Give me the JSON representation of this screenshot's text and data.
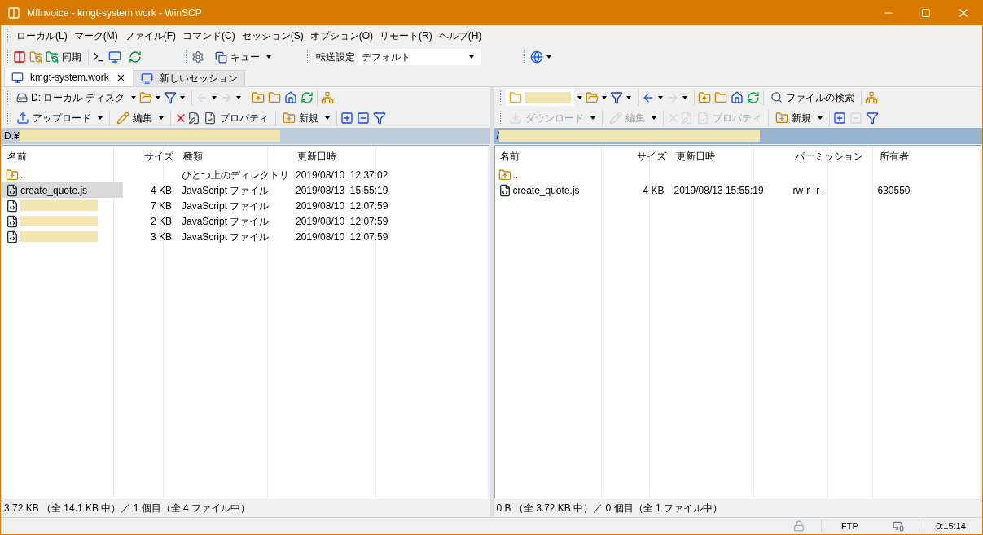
{
  "window": {
    "title": "MfInvoice - kmgt-system.work - WinSCP"
  },
  "menu": [
    "ローカル(L)",
    "マーク(M)",
    "ファイル(F)",
    "コマンド(C)",
    "セッション(S)",
    "オプション(O)",
    "リモート(R)",
    "ヘルプ(H)"
  ],
  "toolbar": {
    "sync": "同期",
    "queue": "キュー",
    "transfer_label": "転送設定",
    "transfer_value": "デフォルト"
  },
  "tabs": [
    {
      "label": "kmgt-system.work",
      "selected": true,
      "closable": true
    },
    {
      "label": "新しいセッション",
      "selected": false,
      "closable": false
    }
  ],
  "panels": [
    {
      "location": "D: ローカル ディスク",
      "location_redacted": false,
      "nav": [
        {
          "disabled": true
        },
        {
          "disabled": true
        }
      ],
      "actions": [
        {
          "kind": "upload",
          "label": "アップロード",
          "disabled": false
        },
        {
          "kind": "edit",
          "label": "編集",
          "disabled": false
        },
        {
          "kind": "props",
          "label": "プロパティ",
          "disabled": false
        },
        {
          "kind": "new",
          "label": "新規",
          "disabled": false
        }
      ],
      "path": "D:¥",
      "active": false,
      "columns": [
        "名前",
        "サイズ",
        "種類",
        "更新日時"
      ],
      "rows": [
        {
          "kind": "parent",
          "redacted": false,
          "selected": false,
          "cells": [
            "..",
            "",
            "ひとつ上のディレクトリ",
            "2019/08/10  12:37:02"
          ]
        },
        {
          "kind": "file",
          "redacted": false,
          "selected": true,
          "cells": [
            "create_quote.js",
            "4 KB",
            "JavaScript ファイル",
            "2019/08/13  15:55:19"
          ]
        },
        {
          "kind": "file",
          "redacted": true,
          "selected": false,
          "cells": [
            "",
            "7 KB",
            "JavaScript ファイル",
            "2019/08/10  12:07:59"
          ]
        },
        {
          "kind": "file",
          "redacted": true,
          "selected": false,
          "cells": [
            "",
            "2 KB",
            "JavaScript ファイル",
            "2019/08/10  12:07:59"
          ]
        },
        {
          "kind": "file",
          "redacted": true,
          "selected": false,
          "cells": [
            "",
            "3 KB",
            "JavaScript ファイル",
            "2019/08/10  12:07:59"
          ]
        }
      ],
      "status": "3.72 KB （全 14.1 KB 中）／ 1 個目（全 4 ファイル中）"
    },
    {
      "location_redacted": true,
      "nav": [
        {
          "disabled": false
        },
        {
          "disabled": true
        }
      ],
      "find": "ファイルの検索",
      "actions": [
        {
          "kind": "download",
          "label": "ダウンロード",
          "disabled": true
        },
        {
          "kind": "edit",
          "label": "編集",
          "disabled": true
        },
        {
          "kind": "props",
          "label": "プロパティ",
          "disabled": true
        },
        {
          "kind": "new",
          "label": "新規",
          "disabled": false
        }
      ],
      "path": "/",
      "active": true,
      "columns": [
        "名前",
        "サイズ",
        "更新日時",
        "パーミッション",
        "所有者"
      ],
      "rows": [
        {
          "kind": "parent",
          "redacted": false,
          "selected": false,
          "cells": [
            "..",
            "",
            "",
            "",
            ""
          ]
        },
        {
          "kind": "file",
          "redacted": false,
          "selected": false,
          "cells": [
            "create_quote.js",
            "4 KB",
            "2019/08/13 15:55:19",
            "rw-r--r--",
            "630550"
          ]
        }
      ],
      "status": "0 B （全 3.72 KB 中）／ 0 個目（全 1 ファイル中）"
    }
  ],
  "status_bar": {
    "protocol": "FTP",
    "time": "0:15:14"
  }
}
